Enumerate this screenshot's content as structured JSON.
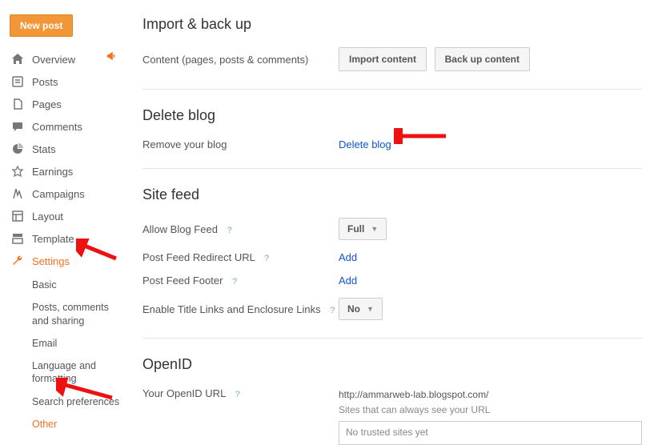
{
  "sidebar": {
    "new_post": "New post",
    "items": [
      {
        "label": "Overview"
      },
      {
        "label": "Posts"
      },
      {
        "label": "Pages"
      },
      {
        "label": "Comments"
      },
      {
        "label": "Stats"
      },
      {
        "label": "Earnings"
      },
      {
        "label": "Campaigns"
      },
      {
        "label": "Layout"
      },
      {
        "label": "Template"
      },
      {
        "label": "Settings"
      }
    ],
    "settings_sub": [
      {
        "label": "Basic"
      },
      {
        "label": "Posts, comments and sharing"
      },
      {
        "label": "Email"
      },
      {
        "label": "Language and formatting"
      },
      {
        "label": "Search preferences"
      },
      {
        "label": "Other"
      }
    ]
  },
  "sections": {
    "import": {
      "heading": "Import & back up",
      "row_label": "Content (pages, posts & comments)",
      "import_btn": "Import content",
      "backup_btn": "Back up content"
    },
    "delete": {
      "heading": "Delete blog",
      "row_label": "Remove your blog",
      "link": "Delete blog"
    },
    "sitefeed": {
      "heading": "Site feed",
      "allow_label": "Allow Blog Feed",
      "allow_value": "Full",
      "redirect_label": "Post Feed Redirect URL",
      "redirect_link": "Add",
      "footer_label": "Post Feed Footer",
      "footer_link": "Add",
      "enable_label": "Enable Title Links and Enclosure Links",
      "enable_value": "No"
    },
    "openid": {
      "heading": "OpenID",
      "url_label": "Your OpenID URL",
      "url_value": "http://ammarweb-lab.blogspot.com/",
      "sites_label": "Sites that can always see your URL",
      "no_trusted": "No trusted sites yet"
    }
  },
  "glyph": {
    "help": "?"
  }
}
